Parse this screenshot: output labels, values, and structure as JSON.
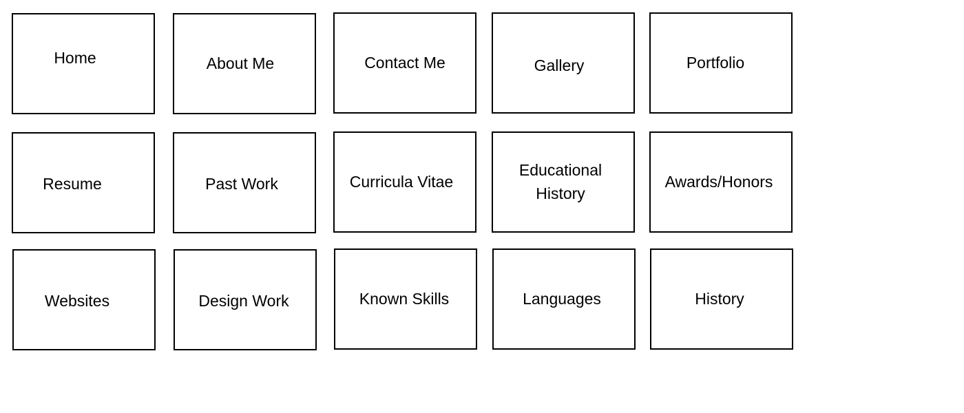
{
  "cards": [
    {
      "label": "Home"
    },
    {
      "label": "About Me"
    },
    {
      "label": "Contact Me"
    },
    {
      "label": "Gallery"
    },
    {
      "label": "Portfolio"
    },
    {
      "label": "Resume"
    },
    {
      "label": "Past Work"
    },
    {
      "label": "Curricula Vitae"
    },
    {
      "label": "Educational History"
    },
    {
      "label": "Awards/Honors"
    },
    {
      "label": "Websites"
    },
    {
      "label": "Design Work"
    },
    {
      "label": "Known Skills"
    },
    {
      "label": "Languages"
    },
    {
      "label": "History"
    }
  ]
}
